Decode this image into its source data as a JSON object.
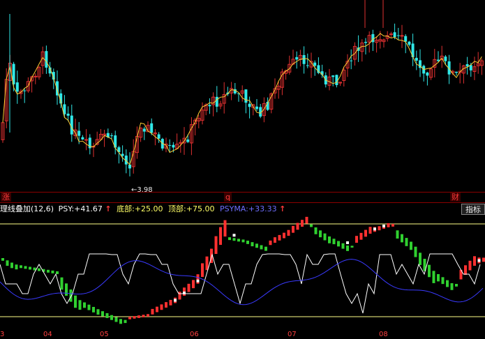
{
  "main_chart": {
    "low_price_label": "3.98",
    "markers": [
      {
        "id": "zhang",
        "text": "涨"
      },
      {
        "id": "q",
        "text": "q"
      },
      {
        "id": "cai",
        "text": "财"
      }
    ],
    "colors": {
      "up": "#e03030",
      "down": "#30e8e8",
      "ma": "#ffcc33",
      "background": "#000000",
      "divider": "#8b0000"
    }
  },
  "indicator": {
    "name": "理线叠加(12,6)",
    "psy_label": "PSY: ",
    "psy_value": "+41.67",
    "psy_arrow": "↑",
    "bottom_label": "底部: ",
    "bottom_value": "+25.00",
    "top_label": "顶部: ",
    "top_value": "+75.00",
    "psyma_label": "PSYMA: ",
    "psyma_value": "+33.33",
    "psyma_arrow": "↑",
    "button_label": "指标",
    "colors": {
      "psy": "#ffffff",
      "psyma": "#3a3aff",
      "bound": "#ffff88",
      "dot_up": "#ff3030",
      "dot_down": "#30d030"
    }
  },
  "x_axis": {
    "labels": [
      "3",
      "04",
      "05",
      "06",
      "07",
      "08"
    ]
  }
}
